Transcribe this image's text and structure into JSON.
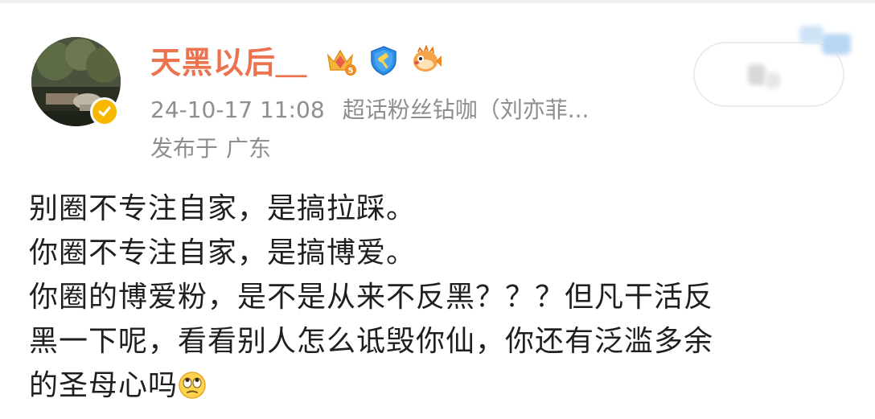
{
  "post": {
    "author": {
      "name": "天黑以后＿",
      "badges": [
        "crown-level-5-icon",
        "shield-hammer-icon",
        "pufferfish-icon"
      ],
      "verified": true,
      "accent_color": "#eb7350"
    },
    "timestamp": "24-10-17 11:08",
    "source": "超话粉丝钻咖（刘亦菲...",
    "location_prefix": "发布于",
    "location": "广东",
    "lines": [
      "别圈不专注自家，是搞拉踩。",
      "你圈不专注自家，是搞博爱。",
      "你圈的博爱粉，是不是从来不反黑？？？但凡干活反",
      "黑一下呢，看看别人怎么诋毁你仙，你还有泛滥多余",
      "的圣母心吗"
    ],
    "trailing_emoji": "eye-roll-emoji"
  }
}
